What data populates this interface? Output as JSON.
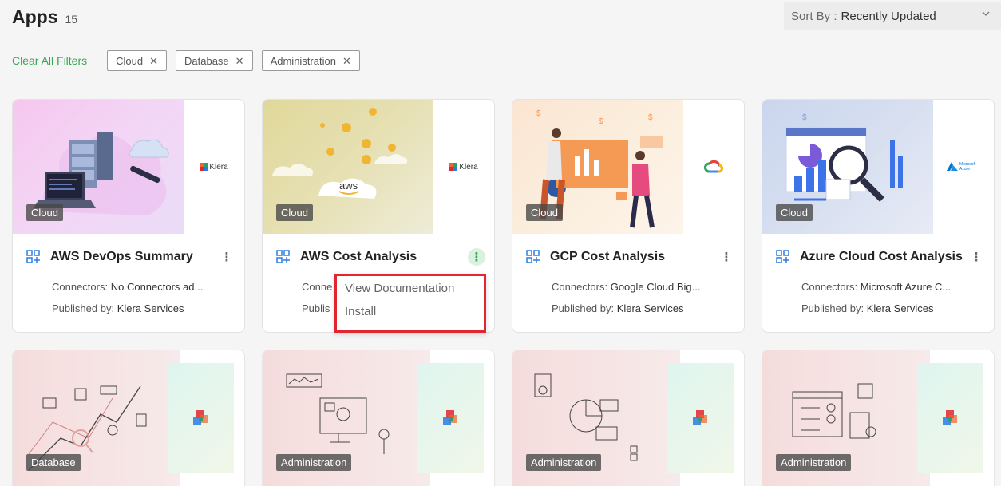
{
  "header": {
    "title": "Apps",
    "count": "15"
  },
  "sort": {
    "label": "Sort By :",
    "value": "Recently Updated"
  },
  "filters": {
    "clear_all": "Clear All Filters",
    "chips": [
      {
        "label": "Cloud"
      },
      {
        "label": "Database"
      },
      {
        "label": "Administration"
      }
    ]
  },
  "cards": [
    {
      "title": "AWS DevOps Summary",
      "tag": "Cloud",
      "connectors_label": "Connectors:",
      "connectors": "No Connectors ad...",
      "published_label": "Published by:",
      "published": "Klera Services",
      "logo_text": "Klera"
    },
    {
      "title": "AWS Cost Analysis",
      "tag": "Cloud",
      "connectors_label": "Conne",
      "connectors": "",
      "published_label": "Publis",
      "published": "",
      "logo_text": "Klera",
      "art_text": "aws"
    },
    {
      "title": "GCP Cost Analysis",
      "tag": "Cloud",
      "connectors_label": "Connectors:",
      "connectors": "Google Cloud Big...",
      "published_label": "Published by:",
      "published": "Klera Services"
    },
    {
      "title": "Azure Cloud Cost Analysis",
      "tag": "Cloud",
      "connectors_label": "Connectors:",
      "connectors": "Microsoft Azure C...",
      "published_label": "Published by:",
      "published": "Klera Services",
      "logo_text": "Microsoft Azure"
    }
  ],
  "menu": {
    "items": [
      "View Documentation",
      "Install"
    ]
  },
  "bottom_cards": [
    {
      "tag": "Database"
    },
    {
      "tag": "Administration"
    },
    {
      "tag": "Administration"
    },
    {
      "tag": "Administration"
    }
  ],
  "colors": {
    "accent": "#3aa655",
    "highlight": "#e0262e"
  }
}
